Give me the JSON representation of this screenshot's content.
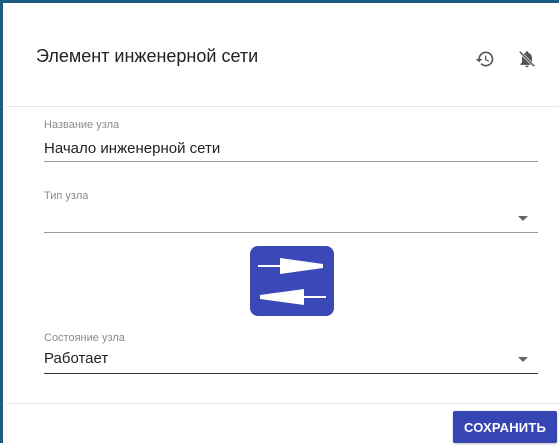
{
  "dialog": {
    "title": "Элемент инженерной сети",
    "icons": {
      "history": "history-icon",
      "notifications_off": "bell-off-icon"
    }
  },
  "form": {
    "node_name": {
      "label": "Название узла",
      "value": "Начало инженерной сети"
    },
    "node_type": {
      "label": "Тип узла",
      "value": ""
    },
    "node_type_icon": "bidirectional-arrows-icon",
    "node_state": {
      "label": "Состояние узла",
      "value": "Работает"
    }
  },
  "footer": {
    "save_label": "СОХРАНИТЬ"
  },
  "colors": {
    "frame_border": "#1c5d86",
    "accent": "#3545b3",
    "type_tile": "#3b48b8"
  }
}
